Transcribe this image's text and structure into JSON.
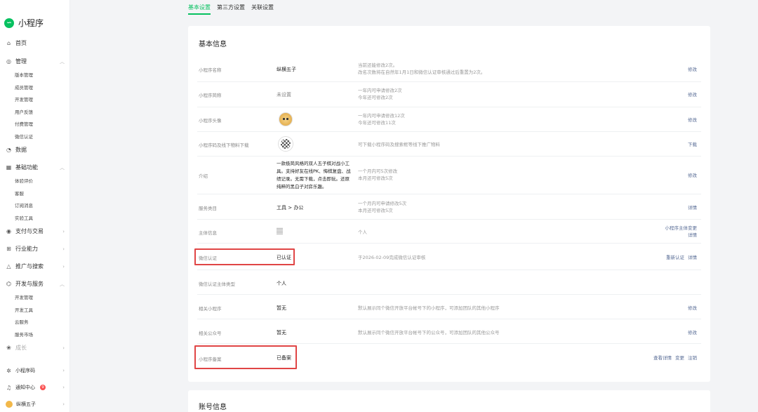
{
  "app": {
    "name": "小程序"
  },
  "sidebar": {
    "home": "首页",
    "manage": {
      "label": "管理",
      "items": [
        "版本管理",
        "成员管理",
        "开发管理",
        "用户反馈",
        "付费管理",
        "微信认证"
      ]
    },
    "data": "数据",
    "basic": {
      "label": "基础功能",
      "items": [
        "体验评价",
        "客服",
        "订阅消息",
        "实验工具"
      ]
    },
    "pay": "支付与交易",
    "industry": "行业能力",
    "promote": "推广与搜索",
    "dev": {
      "label": "开发与服务",
      "items": [
        "开发管理",
        "开发工具",
        "云服务",
        "服务市场"
      ]
    },
    "grow": "成长",
    "qrcode": "小程序码",
    "notify": "通知中心",
    "notify_badge": "9",
    "user": "纵横五子"
  },
  "tabs": [
    {
      "label": "基本设置",
      "active": true
    },
    {
      "label": "第三方设置",
      "active": false
    },
    {
      "label": "关联设置",
      "active": false
    }
  ],
  "card": {
    "title": "基本信息",
    "rows": {
      "name": {
        "label": "小程序名称",
        "value": "纵横五子",
        "desc1": "当前还能修改2次。",
        "desc2": "改名次数将在自然年1月1日和微信认证审核通过后重置为2次。",
        "action": "修改"
      },
      "short": {
        "label": "小程序简称",
        "value": "未设置",
        "desc1": "一年内可申请修改2次",
        "desc2": "今年还可修改2次",
        "action": "修改"
      },
      "avatar": {
        "label": "小程序头像",
        "desc1": "一年内可申请修改12次",
        "desc2": "今年还可修改11次",
        "action": "修改"
      },
      "code": {
        "label": "小程序码及线下物料下载",
        "desc1": "可下载小程序码及搜索框等线下推广物料",
        "action": "下载"
      },
      "intro": {
        "label": "介绍",
        "l1": "一款极简风格的双人五子棋对战小工",
        "l2": "具。支持好友在线PK、悔棋复盘、战",
        "l3": "绩记录。无需下载，点击即玩。还原",
        "l4": "纯粹的黑白子对弈乐趣。",
        "desc1": "一个月内可5次修改",
        "desc2": "本月还可修改5次",
        "action": "修改"
      },
      "category": {
        "label": "服务类目",
        "value": "工具 > 办公",
        "desc1": "一个月内可申请修改5次",
        "desc2": "本月还可修改5次",
        "action": "详情"
      },
      "subject": {
        "label": "主体信息",
        "desc1": "个人",
        "action1": "小程序主体变更",
        "action2": "详情"
      },
      "verify": {
        "label": "微信认证",
        "value": "已认证",
        "desc1": "于2026-02-09完成微信认证审核",
        "action1": "重新认证",
        "action2": "详情"
      },
      "verify_type": {
        "label": "微信认证主体类型",
        "value": "个人"
      },
      "related_mp": {
        "label": "相关小程序",
        "value": "暂无",
        "desc1": "默认展示同个微信开放平台帐号下的小程序，可添加团队的其他小程序",
        "action": "修改"
      },
      "related_oa": {
        "label": "相关公众号",
        "value": "暂无",
        "desc1": "默认展示同个微信开放平台帐号下的公众号，可添加团队的其他公众号",
        "action": "修改"
      },
      "record": {
        "label": "小程序备案",
        "value": "已备案",
        "action1": "查看详情",
        "action2": "变更",
        "action3": "注销"
      }
    }
  },
  "card2": {
    "title": "账号信息"
  },
  "colors": {
    "accent": "#07c160",
    "link": "#576b95",
    "highlight": "#e04545"
  }
}
